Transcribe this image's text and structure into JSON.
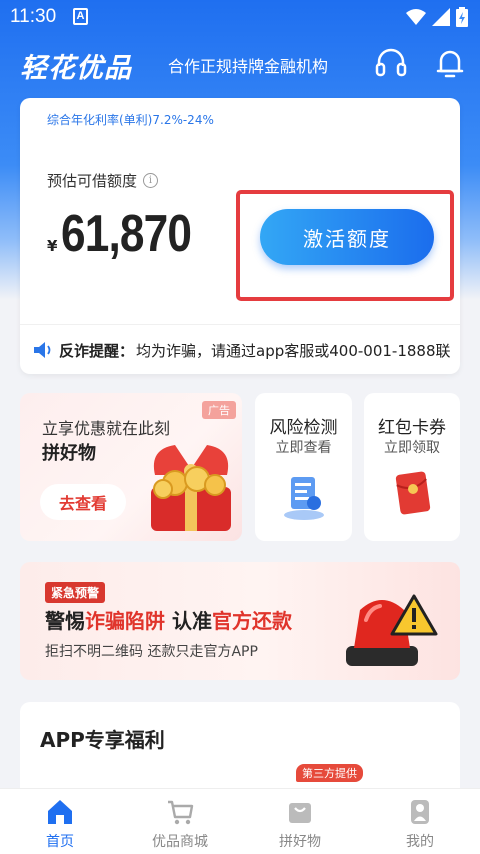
{
  "status_bar": {
    "time": "11:30",
    "app_badge": "A"
  },
  "header": {
    "brand": "轻花优品",
    "slogan": "合作正规持牌金融机构",
    "support_icon": "headset-icon",
    "notification_icon": "bell-icon"
  },
  "credit_card": {
    "rate": "综合年化利率(单利)7.2%-24%",
    "estimate_label": "预估可借额度",
    "info_icon": "i",
    "currency": "¥",
    "amount": "61,870",
    "activate_label": "激活额度",
    "notice_label": "反诈提醒：",
    "notice_text": "均为诈骗，请通过app客服或400-001-1888联"
  },
  "promo": {
    "big": {
      "ad_tag": "广告",
      "line1": "立享优惠就在此刻",
      "line2": "拼好物",
      "button": "去查看"
    },
    "risk": {
      "title": "风险检测",
      "sub": "立即查看"
    },
    "coupon": {
      "title": "红包卡券",
      "sub": "立即领取"
    }
  },
  "warning": {
    "tag": "紧急预警",
    "title_part1": "警惕",
    "title_part2": "诈骗陷阱",
    "title_part3": " 认准",
    "title_part4": "官方还款",
    "sub": "拒扫不明二维码 还款只走官方APP"
  },
  "benefits": {
    "title": "APP专享福利",
    "third_party_tag": "第三方提供"
  },
  "nav": [
    {
      "label": "首页",
      "icon": "home-icon",
      "active": true
    },
    {
      "label": "优品商城",
      "icon": "cart-icon",
      "active": false
    },
    {
      "label": "拼好物",
      "icon": "bag-icon",
      "active": false
    },
    {
      "label": "我的",
      "icon": "user-icon",
      "active": false
    }
  ],
  "colors": {
    "primary": "#1f6ff0",
    "highlight": "#e53c3f",
    "warning": "#e0342b"
  }
}
